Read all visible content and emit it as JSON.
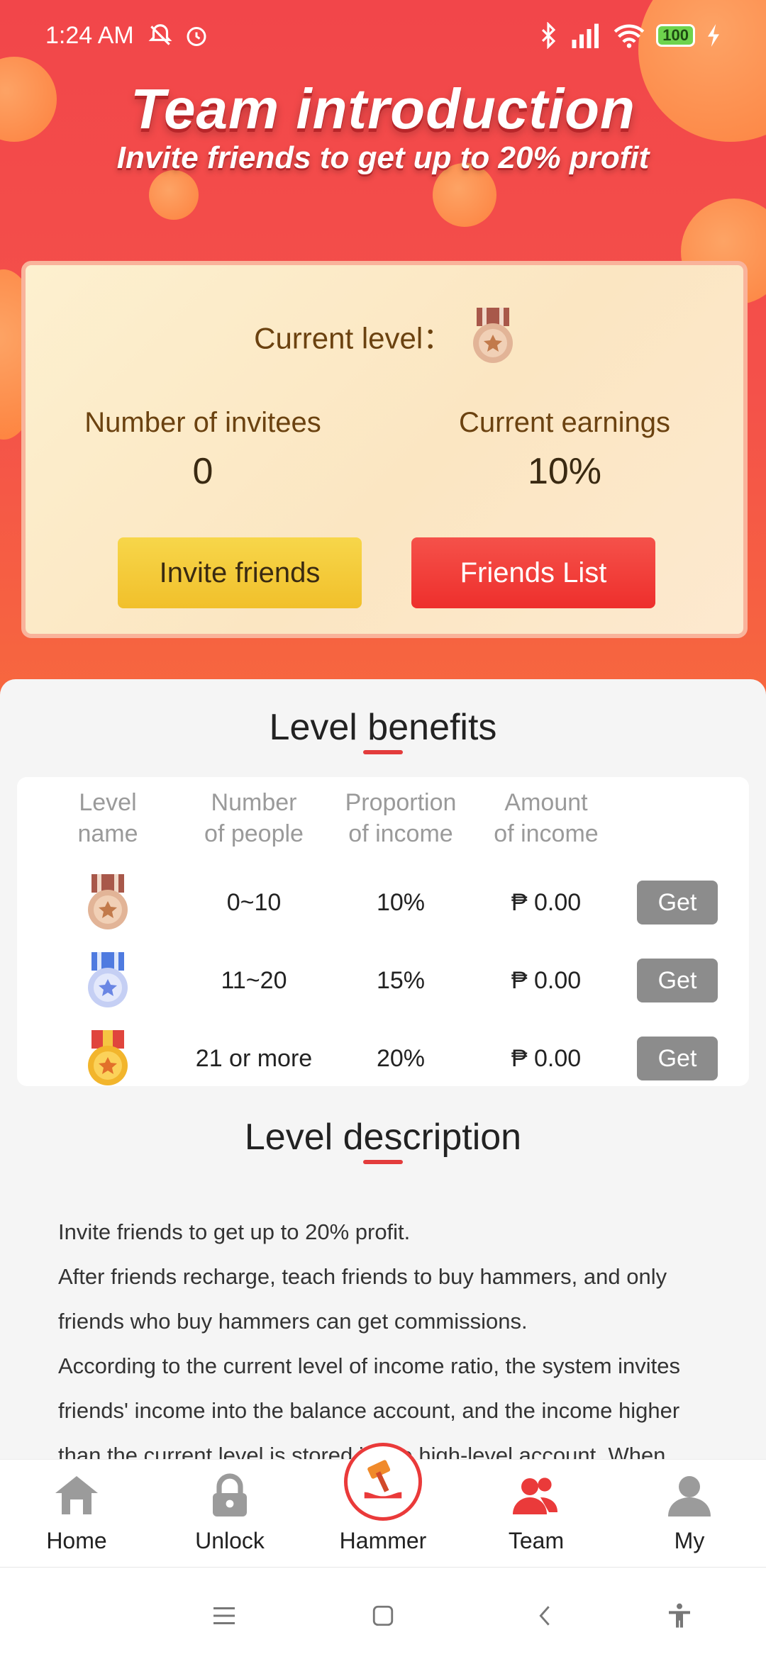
{
  "status_bar": {
    "time": "1:24 AM",
    "battery": "100",
    "icons": [
      "bell-muted-icon",
      "alarm-icon",
      "bluetooth-icon",
      "signal-icon",
      "wifi-icon",
      "battery-icon",
      "charging-icon"
    ]
  },
  "header": {
    "title": "Team introduction",
    "subtitle": "Invite friends to get up to 20% profit"
  },
  "level_card": {
    "current_level_label": "Current level：",
    "invitees_label": "Number of invitees",
    "invitees_value": "0",
    "earnings_label": "Current earnings",
    "earnings_value": "10%",
    "invite_button": "Invite friends",
    "friends_list_button": "Friends List"
  },
  "level_benefits": {
    "title": "Level benefits",
    "columns": [
      [
        "Level",
        "name"
      ],
      [
        "Number",
        "of people"
      ],
      [
        "Proportion",
        "of income"
      ],
      [
        "Amount",
        "of income"
      ]
    ],
    "rows": [
      {
        "medal": "bronze-medal-icon",
        "people": "0~10",
        "proportion": "10%",
        "amount": "₱ 0.00",
        "action": "Get"
      },
      {
        "medal": "silver-medal-icon",
        "people": "11~20",
        "proportion": "15%",
        "amount": "₱ 0.00",
        "action": "Get"
      },
      {
        "medal": "gold-medal-icon",
        "people": "21 or more",
        "proportion": "20%",
        "amount": "₱ 0.00",
        "action": "Get"
      }
    ]
  },
  "level_description": {
    "title": "Level description",
    "lines": [
      "Invite friends to get up to 20% profit.",
      "After friends recharge, teach friends to buy hammers, and only",
      "friends who buy hammers can get commissions.",
      "According to the current level of income ratio, the system invites",
      "friends' income into the balance account, and the income higher",
      "than the current level is stored in the high-level account. When"
    ]
  },
  "tabbar": {
    "items": [
      {
        "label": "Home",
        "icon": "home-icon",
        "active": false
      },
      {
        "label": "Unlock",
        "icon": "lock-icon",
        "active": false
      },
      {
        "label": "Hammer",
        "icon": "hammer-icon",
        "active": false
      },
      {
        "label": "Team",
        "icon": "team-icon",
        "active": true
      },
      {
        "label": "My",
        "icon": "user-icon",
        "active": false
      }
    ]
  },
  "colors": {
    "brand_red": "#f2464a",
    "gold_button": "#f1c02b",
    "get_button": "#8c8c8c",
    "active_tab": "#ea3a3a"
  }
}
